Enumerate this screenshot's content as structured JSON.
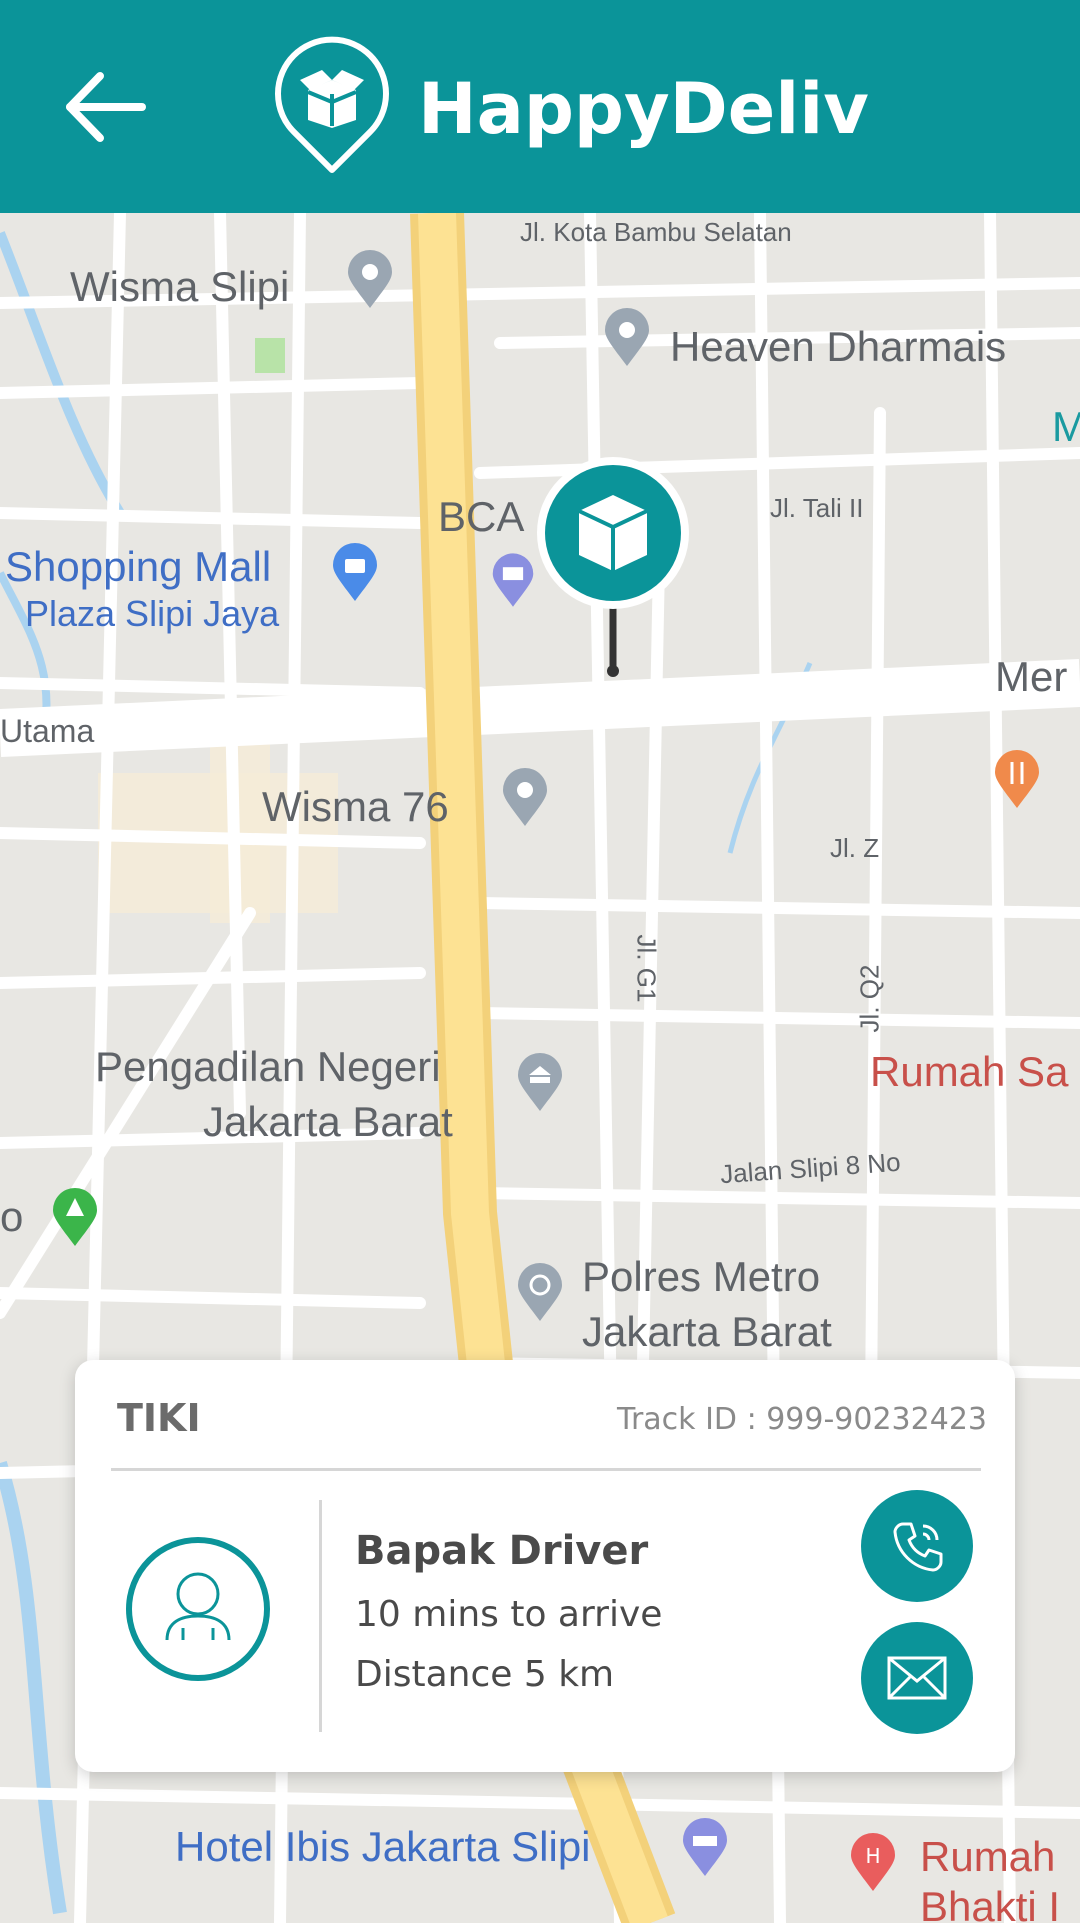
{
  "header": {
    "app_title": "HappyDeliv",
    "back_icon": "arrow-left-icon",
    "logo_icon": "box-pin-logo",
    "background_color": "#0b9499"
  },
  "map": {
    "labels": {
      "kota_bambu": "Jl. Kota Bambu Selatan",
      "wisma_slipi": "Wisma Slipi",
      "heaven": "Heaven Dharmais",
      "m_edge": "M",
      "bca": "BCA",
      "tali": "Jl. Tali II",
      "shopping_mall": "Shopping Mall",
      "plaza": "Plaza Slipi Jaya",
      "utama": "Utama",
      "mer": "Mer",
      "wisma_76": "Wisma 76",
      "jl_z": "Jl. Z",
      "jl_g1": "Jl. G1",
      "jl_q2": "Jl. Q2",
      "rumah_sa": "Rumah Sa",
      "pengadilan_1": "Pengadilan Negeri",
      "pengadilan_2": "Jakarta Barat",
      "slipi_8": "Jalan Slipi 8 No",
      "o_edge": "o",
      "polres_1": "Polres Metro",
      "polres_2": "Jakarta Barat",
      "hotel_ibis": "Hotel Ibis Jakarta Slipi",
      "rumah_2": "Rumah",
      "rumah_3": "Bhakti I"
    },
    "marker_icon": "package-box-icon"
  },
  "card": {
    "courier": "TIKI",
    "track_id": "Track ID : 999-90232423",
    "driver_name": "Bapak Driver",
    "eta": "10 mins to arrive",
    "distance": "Distance 5 km",
    "avatar_icon": "user-avatar-icon",
    "call_icon": "phone-icon",
    "message_icon": "envelope-icon",
    "accent_color": "#0b9499"
  }
}
